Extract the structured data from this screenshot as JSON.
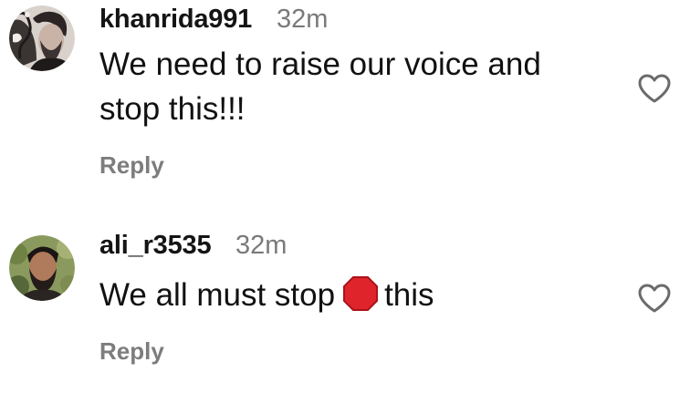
{
  "comments": [
    {
      "username": "khanrida991",
      "time": "32m",
      "lines": [
        "We need to raise our voice and",
        "stop this!!!"
      ],
      "reply_label": "Reply",
      "avatar_icon": "avatar-khanrida991",
      "like_icon": "heart-outline-icon"
    },
    {
      "username": "ali_r3535",
      "time": "32m",
      "text_before": "We all must stop",
      "emoji": "stop-sign-emoji",
      "text_after": "this",
      "reply_label": "Reply",
      "avatar_icon": "avatar-ali_r3535",
      "like_icon": "heart-outline-icon"
    }
  ],
  "colors": {
    "username": "#141414",
    "timestamp": "#7a7a7a",
    "reply": "#7d7d7d",
    "stop_sign": "#e0242b",
    "heart_outline": "#6b6b6b"
  }
}
